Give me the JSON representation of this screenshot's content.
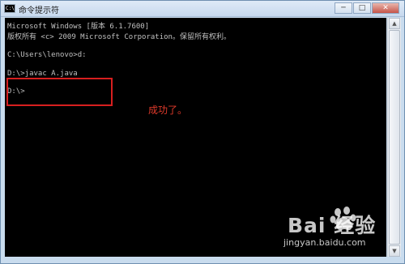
{
  "window": {
    "title": "命令提示符",
    "icon": "cmd-icon",
    "controls": [
      "minimize-icon",
      "maximize-icon",
      "close-icon"
    ]
  },
  "console": {
    "lines": [
      "Microsoft Windows [版本 6.1.7600]",
      "版权所有 <c> 2009 Microsoft Corporation。保留所有权利。",
      "",
      "C:\\Users\\lenovo>d:",
      "",
      "D:\\>javac A.java",
      "",
      "D:\\>"
    ]
  },
  "annotation": {
    "text": "成功了。",
    "color": "#e03a2b"
  },
  "watermark": {
    "logo": "Bai 经验",
    "url": "jingyan.baidu.com"
  }
}
